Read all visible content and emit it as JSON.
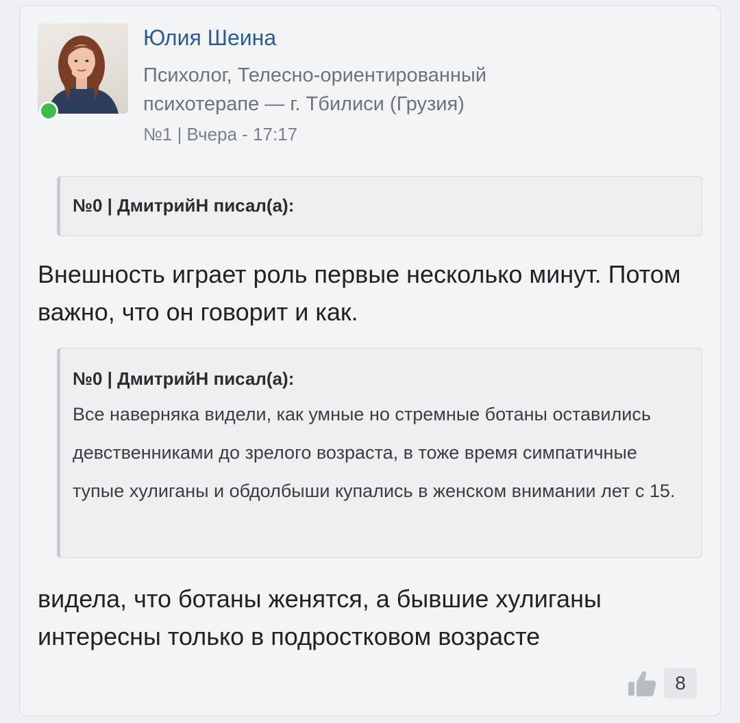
{
  "post": {
    "author": {
      "name": "Юлия Шеина",
      "status": "Психолог, Телесно-ориентированный психотерапе — г. Тбилиси (Грузия)",
      "online": true
    },
    "meta": "№1 | Вчера - 17:17",
    "quotes": [
      {
        "header": "№0 | ДмитрийН писал(а):",
        "body": ""
      },
      {
        "header": "№0 | ДмитрийН писал(а):",
        "body": "Все наверняка видели, как умные но стремные ботаны оставились девственниками до зрелого возраста, в тоже время симпатичные тупые хулиганы и обдолбыши купались в женском внимании лет с 15."
      }
    ],
    "texts": [
      "Внешность играет роль первые несколько минут. Потом важно, что он говорит и как.",
      "видела, что ботаны женятся, а бывшие хулиганы интересны только в подростковом возрасте"
    ],
    "likes": {
      "icon": "thumbs-up-icon",
      "count": "8"
    }
  },
  "colors": {
    "author_name": "#2d5b8e",
    "online": "#3dbd4d",
    "card_bg": "#f3f4f6"
  }
}
